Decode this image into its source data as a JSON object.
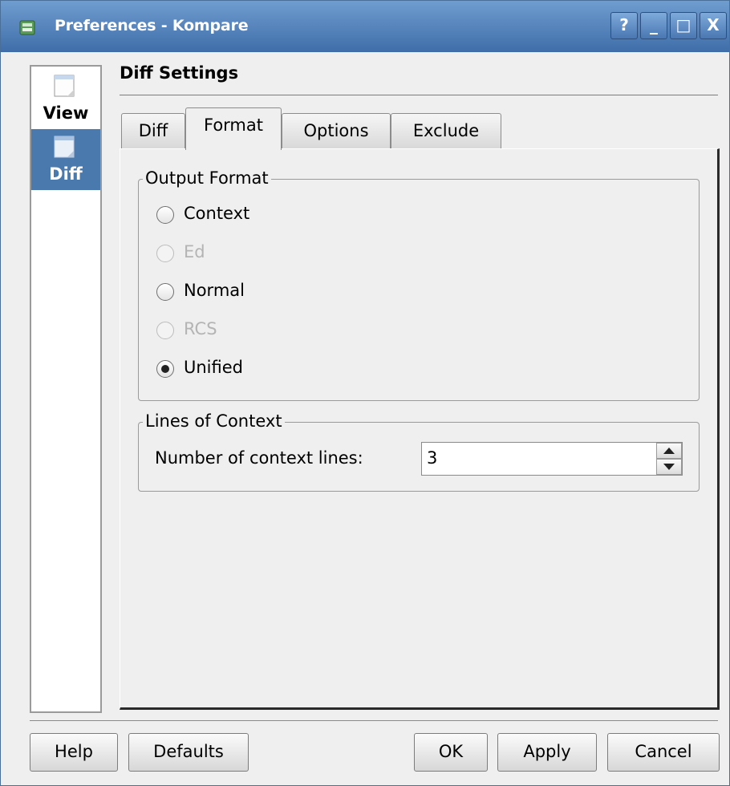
{
  "window": {
    "title": "Preferences - Kompare",
    "title_buttons": [
      "?",
      "_",
      "□",
      "X"
    ],
    "icons": [
      "kompare-app-icon",
      "help-icon",
      "minimize-icon",
      "maximize-icon",
      "close-icon"
    ],
    "colors": {
      "titlebar": "#4f7fba",
      "selection": "#4a79ad",
      "background": "#efefef"
    }
  },
  "sidebar": {
    "items": [
      {
        "label": "View",
        "icon": "page-icon",
        "selected": false
      },
      {
        "label": "Diff",
        "icon": "page-icon",
        "selected": true
      }
    ]
  },
  "page": {
    "heading": "Diff Settings"
  },
  "tabs": [
    {
      "label": "Diff",
      "mnemonic": "i",
      "active": false
    },
    {
      "label": "Format",
      "mnemonic": "F",
      "active": true
    },
    {
      "label": "Options",
      "mnemonic": "p",
      "active": false
    },
    {
      "label": "Exclude",
      "mnemonic": "E",
      "active": false
    }
  ],
  "output_format": {
    "title": "Output Format",
    "options": [
      {
        "label": "Context",
        "mnemonic": "t",
        "checked": false,
        "enabled": true
      },
      {
        "label": "Ed",
        "checked": false,
        "enabled": false
      },
      {
        "label": "Normal",
        "mnemonic": "N",
        "checked": false,
        "enabled": true
      },
      {
        "label": "RCS",
        "mnemonic": "R",
        "checked": false,
        "enabled": false
      },
      {
        "label": "Unified",
        "mnemonic": "U",
        "checked": true,
        "enabled": true
      }
    ]
  },
  "lines_of_context": {
    "title": "Lines of Context",
    "label": "Number of context lines:",
    "value": "3"
  },
  "buttons": {
    "help": "Help",
    "defaults": "Defaults",
    "ok": "OK",
    "apply": "Apply",
    "cancel": "Cancel"
  }
}
